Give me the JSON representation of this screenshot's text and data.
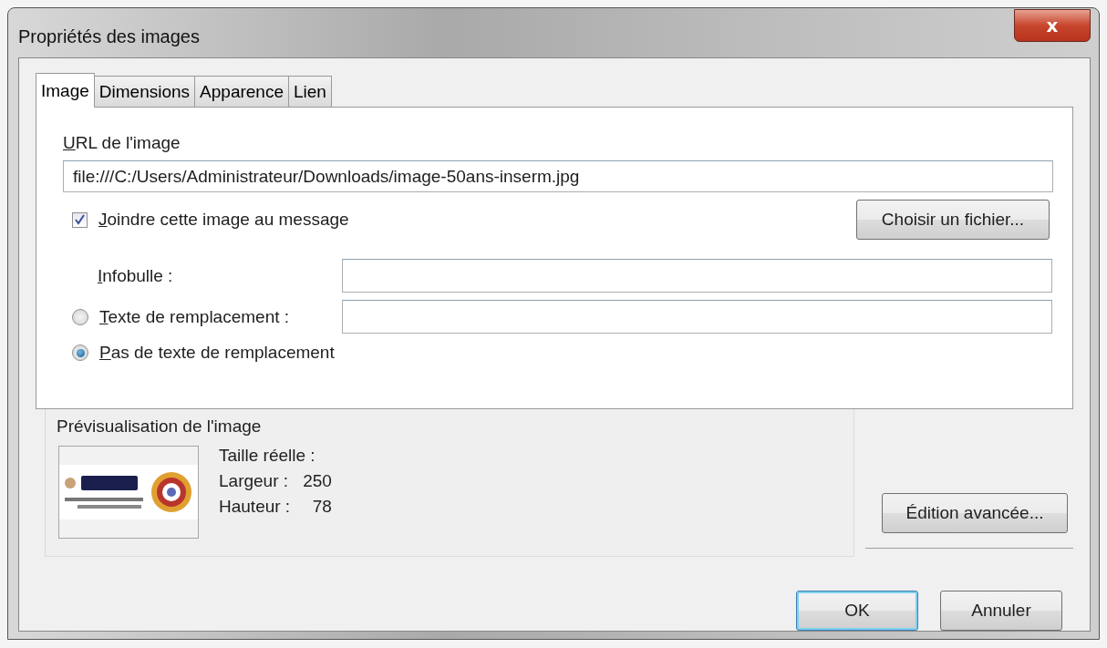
{
  "window": {
    "title": "Propriétés des images",
    "close_label": "x"
  },
  "tabs": [
    {
      "label": "Image",
      "selected": true
    },
    {
      "label": "Dimensions",
      "selected": false
    },
    {
      "label": "Apparence",
      "selected": false
    },
    {
      "label": "Lien",
      "selected": false
    }
  ],
  "url": {
    "label": "URL de l'image",
    "value": "file:///C:/Users/Administrateur/Downloads/image-50ans-inserm.jpg"
  },
  "attach": {
    "label": "Joindre cette image au message",
    "checked": true
  },
  "choose_button": "Choisir un fichier...",
  "tooltip": {
    "label": "Infobulle :"
  },
  "alt_options": [
    {
      "label": "Texte de remplacement :",
      "selected": false,
      "kind": "field"
    },
    {
      "label": "Pas de texte de remplacement",
      "selected": true,
      "kind": "plain"
    }
  ],
  "preview": {
    "legend": "Prévisualisation de l'image",
    "size_label": "Taille réelle :",
    "width_label": "Largeur :",
    "width_value": "250",
    "height_label": "Hauteur :",
    "height_value": "78"
  },
  "advanced_button": "Édition avancée...",
  "buttons": [
    {
      "label": "OK",
      "kind": "default"
    },
    {
      "label": "Annuler",
      "kind": "normal"
    }
  ]
}
